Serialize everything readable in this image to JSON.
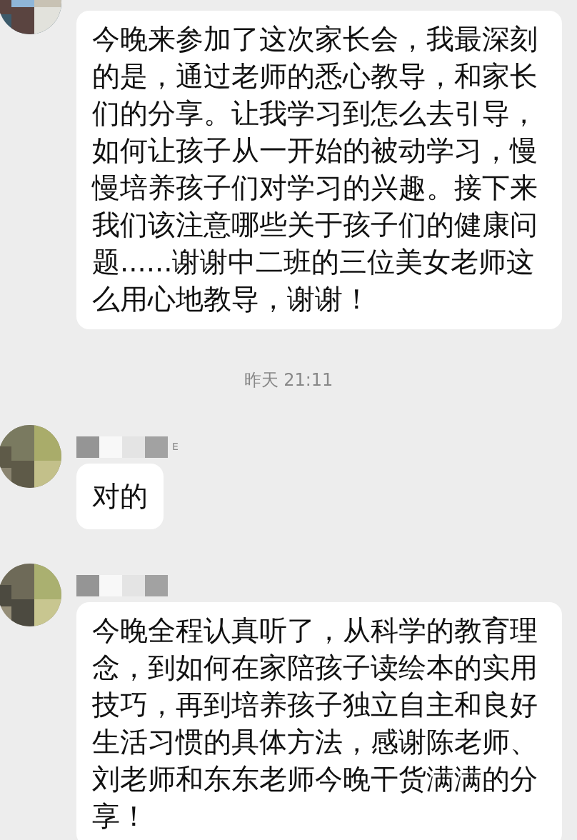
{
  "messages": [
    {
      "kind": "text",
      "show_name": false,
      "text": "今晚来参加了这次家长会，我最深刻的是，通过老师的悉心教导，和家长们的分享。让我学习到怎么去引导，如何让孩子从一开始的被动学习，慢慢培养孩子们对学习的兴趣。接下来我们该注意哪些关于孩子们的健康问题......谢谢中二班的三位美女老师这么用心地教导，谢谢！"
    },
    {
      "kind": "time",
      "text": "昨天 21:11"
    },
    {
      "kind": "text",
      "show_name": true,
      "name_fragment": "E",
      "text": "对的"
    },
    {
      "kind": "text",
      "show_name": true,
      "text": "今晚全程认真听了，从科学的教育理念，到如何在家陪孩子读绘本的实用技巧，再到培养孩子独立自主和良好生活习惯的具体方法，感谢陈老师、刘老师和东东老师今晚干货满满的分享！"
    }
  ]
}
